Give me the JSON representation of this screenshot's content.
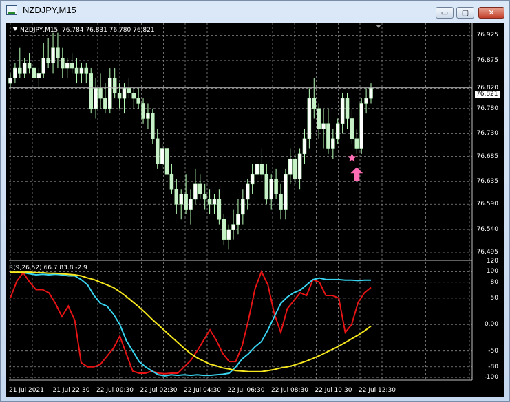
{
  "window": {
    "title": "NZDJPY,M15"
  },
  "title_buttons": {
    "minimize": "▭",
    "maximize": "▢",
    "close": "✕"
  },
  "chart_header": {
    "symbol": "NZDJPY,M15",
    "ohlc": "76.784 76.831 76.780 76.821"
  },
  "indicator_header": "R(9,26,52) 66.7 83.8 -2.9",
  "current_price": "76.821",
  "colors": {
    "background": "#000000",
    "grid": "#8a8a8a",
    "candle_bull": "#ffffff",
    "candle_bear": "#c8f0c8",
    "wick": "#b8ffb8",
    "rsi_fast": "#e61414",
    "rsi_mid": "#38d4f0",
    "rsi_slow": "#f5e61e",
    "signal": "#ff6eb4"
  },
  "chart_data": [
    {
      "type": "candlestick",
      "title": "NZDJPY,M15",
      "ylim": [
        76.48,
        76.95
      ],
      "price_ticks": [
        "76.925",
        "76.875",
        "76.820",
        "76.780",
        "76.730",
        "76.685",
        "76.635",
        "76.590",
        "76.540",
        "76.495"
      ],
      "time_ticks": [
        "21 Jul 2021",
        "21 Jul 22:30",
        "22 Jul 00:30",
        "22 Jul 02:30",
        "22 Jul 04:30",
        "22 Jul 06:30",
        "22 Jul 08:30",
        "22 Jul 10:30",
        "22 Jul 12:30"
      ],
      "current_price": 76.821,
      "candles": [
        [
          76.83,
          76.85,
          76.82,
          76.84
        ],
        [
          76.84,
          76.87,
          76.83,
          76.86
        ],
        [
          76.86,
          76.9,
          76.84,
          76.85
        ],
        [
          76.85,
          76.88,
          76.84,
          76.87
        ],
        [
          76.87,
          76.89,
          76.85,
          76.86
        ],
        [
          76.86,
          76.88,
          76.82,
          76.84
        ],
        [
          76.84,
          76.86,
          76.82,
          76.85
        ],
        [
          76.85,
          76.91,
          76.84,
          76.88
        ],
        [
          76.88,
          76.92,
          76.86,
          76.87
        ],
        [
          76.87,
          76.93,
          76.85,
          76.9
        ],
        [
          76.9,
          76.93,
          76.86,
          76.88
        ],
        [
          76.88,
          76.9,
          76.84,
          76.86
        ],
        [
          76.86,
          76.88,
          76.84,
          76.87
        ],
        [
          76.87,
          76.89,
          76.85,
          76.86
        ],
        [
          76.86,
          76.88,
          76.83,
          76.85
        ],
        [
          76.85,
          76.87,
          76.83,
          76.86
        ],
        [
          76.86,
          76.87,
          76.83,
          76.85
        ],
        [
          76.85,
          76.86,
          76.77,
          76.78
        ],
        [
          76.78,
          76.84,
          76.76,
          76.82
        ],
        [
          76.82,
          76.85,
          76.78,
          76.8
        ],
        [
          76.8,
          76.83,
          76.77,
          76.78
        ],
        [
          76.78,
          76.86,
          76.77,
          76.84
        ],
        [
          76.84,
          76.86,
          76.8,
          76.81
        ],
        [
          76.81,
          76.83,
          76.78,
          76.8
        ],
        [
          76.8,
          76.83,
          76.77,
          76.82
        ],
        [
          76.82,
          76.84,
          76.8,
          76.81
        ],
        [
          76.81,
          76.82,
          76.78,
          76.8
        ],
        [
          76.8,
          76.82,
          76.78,
          76.79
        ],
        [
          76.79,
          76.8,
          76.75,
          76.76
        ],
        [
          76.76,
          76.79,
          76.74,
          76.77
        ],
        [
          76.77,
          76.78,
          76.71,
          76.72
        ],
        [
          76.72,
          76.74,
          76.66,
          76.67
        ],
        [
          76.67,
          76.71,
          76.66,
          76.7
        ],
        [
          76.7,
          76.71,
          76.64,
          76.65
        ],
        [
          76.65,
          76.67,
          76.61,
          76.62
        ],
        [
          76.62,
          76.64,
          76.57,
          76.59
        ],
        [
          76.59,
          76.62,
          76.56,
          76.61
        ],
        [
          76.61,
          76.65,
          76.57,
          76.58
        ],
        [
          76.58,
          76.62,
          76.55,
          76.6
        ],
        [
          76.6,
          76.66,
          76.59,
          76.63
        ],
        [
          76.63,
          76.65,
          76.6,
          76.61
        ],
        [
          76.61,
          76.63,
          76.58,
          76.6
        ],
        [
          76.6,
          76.62,
          76.57,
          76.59
        ],
        [
          76.59,
          76.61,
          76.57,
          76.6
        ],
        [
          76.6,
          76.62,
          76.55,
          76.56
        ],
        [
          76.56,
          76.57,
          76.51,
          76.52
        ],
        [
          76.52,
          76.55,
          76.5,
          76.54
        ],
        [
          76.54,
          76.58,
          76.52,
          76.55
        ],
        [
          76.55,
          76.6,
          76.53,
          76.57
        ],
        [
          76.57,
          76.62,
          76.55,
          76.6
        ],
        [
          76.6,
          76.64,
          76.58,
          76.63
        ],
        [
          76.63,
          76.67,
          76.61,
          76.65
        ],
        [
          76.65,
          76.69,
          76.63,
          76.67
        ],
        [
          76.67,
          76.7,
          76.64,
          76.65
        ],
        [
          76.65,
          76.67,
          76.59,
          76.6
        ],
        [
          76.6,
          76.65,
          76.58,
          76.64
        ],
        [
          76.64,
          76.66,
          76.6,
          76.61
        ],
        [
          76.61,
          76.63,
          76.56,
          76.58
        ],
        [
          76.58,
          76.66,
          76.56,
          76.65
        ],
        [
          76.65,
          76.7,
          76.63,
          76.68
        ],
        [
          76.68,
          76.69,
          76.63,
          76.64
        ],
        [
          76.64,
          76.7,
          76.62,
          76.69
        ],
        [
          76.69,
          76.74,
          76.67,
          76.72
        ],
        [
          76.72,
          76.82,
          76.7,
          76.8
        ],
        [
          76.8,
          76.84,
          76.76,
          76.78
        ],
        [
          76.78,
          76.79,
          76.72,
          76.74
        ],
        [
          76.74,
          76.78,
          76.7,
          76.75
        ],
        [
          76.75,
          76.78,
          76.69,
          76.7
        ],
        [
          76.7,
          76.74,
          76.68,
          76.72
        ],
        [
          76.72,
          76.76,
          76.71,
          76.75
        ],
        [
          76.75,
          76.81,
          76.73,
          76.8
        ],
        [
          76.8,
          76.81,
          76.74,
          76.76
        ],
        [
          76.76,
          76.78,
          76.71,
          76.72
        ],
        [
          76.72,
          76.74,
          76.69,
          76.7
        ],
        [
          76.7,
          76.8,
          76.69,
          76.79
        ],
        [
          76.79,
          76.82,
          76.77,
          76.8
        ],
        [
          76.8,
          76.83,
          76.79,
          76.82
        ]
      ],
      "signals": [
        {
          "type": "star",
          "candle": 72,
          "price": 76.682
        },
        {
          "type": "arrow-up",
          "candle": 73,
          "price": 76.65
        }
      ]
    },
    {
      "type": "line",
      "title": "R(9,26,52)",
      "ylim": [
        -105,
        120
      ],
      "y_ticks": [
        "120",
        "100",
        "80",
        "50",
        "0.00",
        "-50",
        "-80",
        "-100"
      ],
      "series": [
        {
          "values": [
            50,
            82,
            98,
            80,
            66,
            66,
            60,
            40,
            15,
            35,
            8,
            -72,
            -80,
            -80,
            -75,
            -60,
            -45,
            -22,
            -55,
            -88,
            -92,
            -92,
            -88,
            -92,
            -93,
            -92,
            -92,
            -80,
            -68,
            -50,
            -30,
            -10,
            -30,
            -55,
            -70,
            -70,
            -40,
            10,
            68,
            100,
            75,
            20,
            -15,
            30,
            45,
            60,
            55,
            85,
            80,
            55,
            55,
            50,
            -15,
            0,
            42,
            60,
            70
          ]
        },
        {
          "values": [
            98,
            98,
            98,
            96,
            94,
            95,
            94,
            95,
            94,
            92,
            92,
            85,
            75,
            55,
            40,
            35,
            20,
            0,
            -30,
            -50,
            -70,
            -80,
            -88,
            -95,
            -97,
            -95,
            -96,
            -95,
            -96,
            -95,
            -96,
            -96,
            -95,
            -94,
            -92,
            -80,
            -65,
            -55,
            -42,
            -32,
            -10,
            15,
            40,
            52,
            60,
            65,
            75,
            85,
            88,
            85,
            85,
            85,
            84,
            84,
            83,
            84,
            84
          ]
        },
        {
          "values": [
            99,
            99,
            99,
            99,
            98,
            98,
            97,
            97,
            96,
            95,
            94,
            92,
            88,
            85,
            80,
            75,
            70,
            62,
            53,
            43,
            33,
            22,
            10,
            -1,
            -12,
            -23,
            -34,
            -45,
            -55,
            -63,
            -69,
            -75,
            -78,
            -82,
            -84,
            -87,
            -88,
            -89,
            -89,
            -89,
            -87,
            -85,
            -82,
            -80,
            -77,
            -73,
            -69,
            -64,
            -59,
            -53,
            -47,
            -41,
            -34,
            -27,
            -20,
            -12,
            -3
          ]
        }
      ]
    }
  ]
}
